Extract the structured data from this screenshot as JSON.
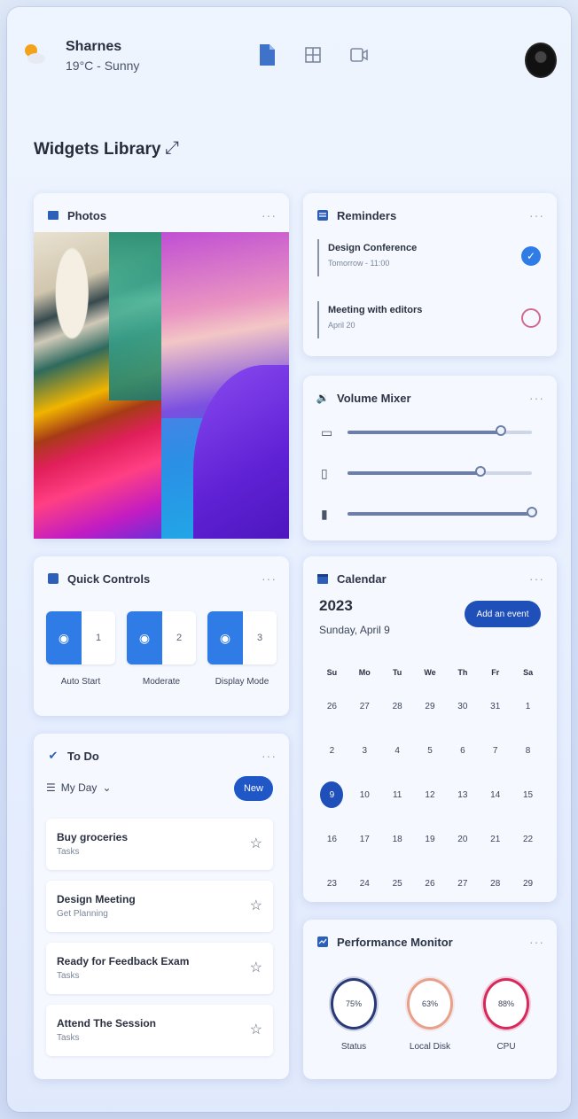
{
  "header": {
    "city": "Sharnes",
    "condition": "19°C - Sunny",
    "weather_icon": "sun-cloud-icon",
    "icons": [
      "document-icon",
      "grid-icon",
      "video-icon"
    ],
    "avatar": "avatar"
  },
  "library": {
    "title": "Widgets Library",
    "expand_icon": "expand-icon"
  },
  "photos": {
    "title": "Photos"
  },
  "quick_controls": {
    "title": "Quick Controls",
    "items": [
      {
        "label": "Auto Start",
        "state": "1"
      },
      {
        "label": "Moderate",
        "state": "2"
      },
      {
        "label": "Display Mode",
        "state": "3"
      }
    ]
  },
  "todo": {
    "title": "To Do",
    "list_name": "My Day",
    "new_label": "New",
    "items": [
      {
        "title": "Buy groceries",
        "subtitle": "Tasks"
      },
      {
        "title": "Design Meeting",
        "subtitle": "Get Planning"
      },
      {
        "title": "Ready for Feedback Exam",
        "subtitle": "Tasks"
      },
      {
        "title": "Attend The Session",
        "subtitle": "Tasks"
      }
    ]
  },
  "reminders": {
    "title": "Reminders",
    "items": [
      {
        "title": "Design Conference",
        "subtitle": "Tomorrow - 11:00",
        "done": true
      },
      {
        "title": "Meeting with editors",
        "subtitle": "April 20",
        "done": false
      }
    ]
  },
  "volume": {
    "title": "Volume Mixer",
    "levels": [
      0.83,
      0.72,
      1.0
    ],
    "icons": [
      "speaker-icon",
      "music-icon",
      "mic-icon"
    ]
  },
  "calendar": {
    "title": "Calendar",
    "year": "2023",
    "date": "Sunday, April 9",
    "add_label": "Add an event",
    "weekdays": [
      "Su",
      "Mo",
      "Tu",
      "We",
      "Th",
      "Fr",
      "Sa"
    ],
    "weeks": [
      [
        "26",
        "27",
        "28",
        "29",
        "30",
        "31",
        "1"
      ],
      [
        "2",
        "3",
        "4",
        "5",
        "6",
        "7",
        "8"
      ],
      [
        "9",
        "10",
        "11",
        "12",
        "13",
        "14",
        "15"
      ],
      [
        "16",
        "17",
        "18",
        "19",
        "20",
        "21",
        "22"
      ],
      [
        "23",
        "24",
        "25",
        "26",
        "27",
        "28",
        "29"
      ]
    ],
    "selected": "9"
  },
  "performance": {
    "title": "Performance Monitor",
    "items": [
      {
        "label": "Status",
        "value": "75%",
        "color": "#2a3a78"
      },
      {
        "label": "Local Disk",
        "value": "63%",
        "color": "#e8a08a"
      },
      {
        "label": "CPU",
        "value": "88%",
        "color": "#d9285a"
      }
    ]
  },
  "colors": {
    "accent": "#1f4fb8",
    "toggle": "#2f7ce6"
  }
}
